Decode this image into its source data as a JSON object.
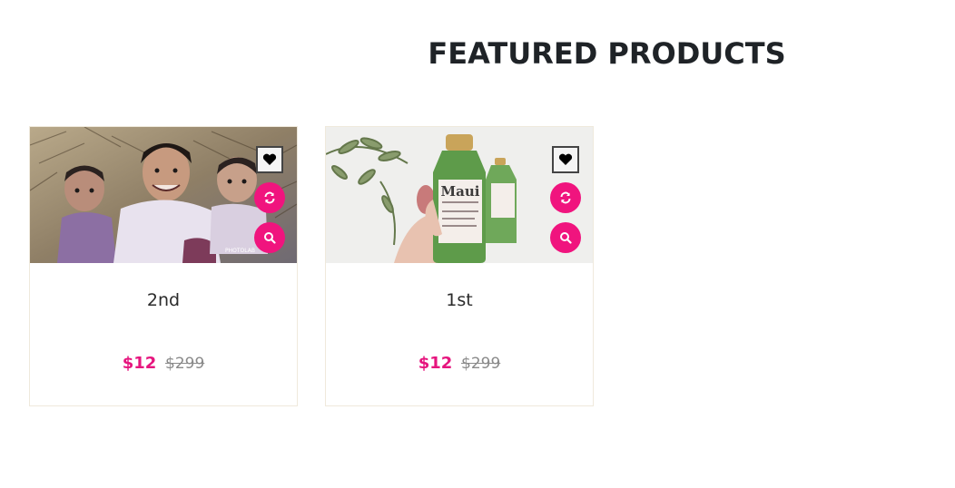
{
  "section": {
    "title": "FEATURED PRODUCTS"
  },
  "products": [
    {
      "name": "2nd",
      "price": "$12",
      "old_price": "$299",
      "image_alt": "man with two children cartoon filter photo",
      "image_watermark": "PHOTOLAB",
      "actions": {
        "wishlist_icon": "heart-icon",
        "compare_icon": "refresh-icon",
        "quickview_icon": "search-icon"
      }
    },
    {
      "name": "1st",
      "price": "$12",
      "old_price": "$299",
      "image_alt": "hand holding green Maui Moisture shampoo bottle",
      "image_brand": "Maui",
      "actions": {
        "wishlist_icon": "heart-icon",
        "compare_icon": "refresh-icon",
        "quickview_icon": "search-icon"
      }
    }
  ],
  "colors": {
    "accent": "#f0147e",
    "price": "#e6157e",
    "old_price": "#8a8a8a",
    "card_border": "#efe9dc"
  }
}
